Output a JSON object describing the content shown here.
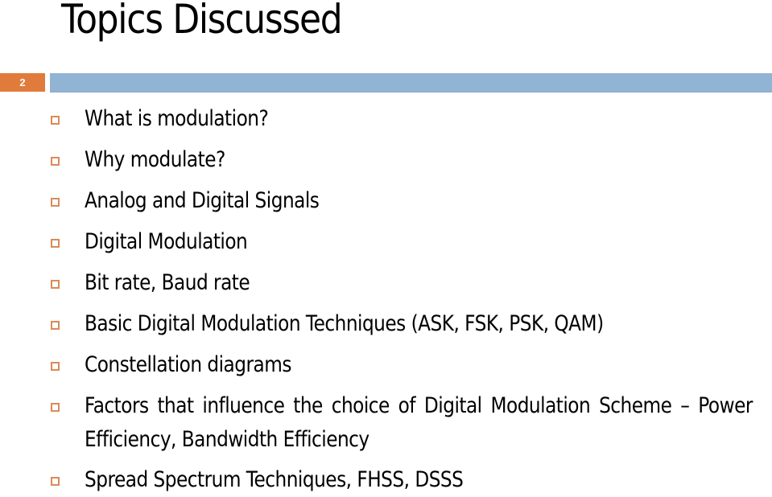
{
  "slide": {
    "title": "Topics Discussed",
    "slide_number": "2"
  },
  "colors": {
    "slide_number_bg": "#e07b3c",
    "header_bar": "#92b4d4",
    "bullet_border": "#d98c5a",
    "text": "#000000"
  },
  "bullet_icon": "hollow-square-bullet",
  "items": [
    {
      "text": "What is modulation?"
    },
    {
      "text": "Why modulate?"
    },
    {
      "text": "Analog and Digital Signals"
    },
    {
      "text": "Digital Modulation"
    },
    {
      "text": "Bit rate, Baud rate"
    },
    {
      "text": "Basic Digital Modulation Techniques (ASK, FSK, PSK, QAM)"
    },
    {
      "text": "Constellation diagrams"
    },
    {
      "text": "Factors that influence the choice of Digital Modulation Scheme – Power Efficiency, Bandwidth Efficiency"
    },
    {
      "text": "Spread Spectrum Techniques, FHSS, DSSS"
    }
  ]
}
